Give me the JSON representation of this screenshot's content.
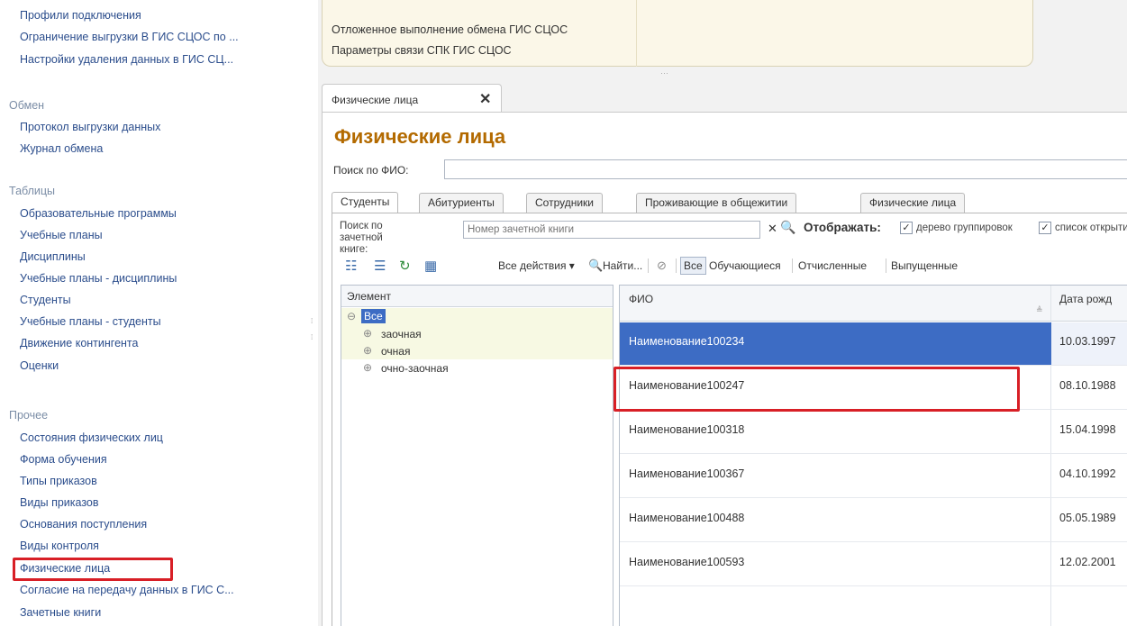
{
  "nav": {
    "items_top": [
      "Профили подключения",
      "Ограничение выгрузки В ГИС СЦОС по ...",
      "Настройки удаления данных в ГИС СЦ..."
    ],
    "section_exchange": "Обмен",
    "items_exchange": [
      "Протокол выгрузки данных",
      "Журнал обмена"
    ],
    "section_tables": "Таблицы",
    "items_tables": [
      "Образовательные программы",
      "Учебные планы",
      "Дисциплины",
      "Учебные планы - дисциплины",
      "Студенты",
      "Учебные планы - студенты",
      "Движение контингента",
      "Оценки"
    ],
    "section_other": "Прочее",
    "items_other": [
      "Состояния физических лиц",
      "Форма обучения",
      "Типы приказов",
      "Виды приказов",
      "Основания поступления",
      "Виды контроля",
      "Физические лица",
      "Согласие на передачу данных в ГИС С...",
      "Зачетные книги"
    ]
  },
  "top_panel": {
    "links": [
      "Отложенное выполнение обмена ГИС СЦОС",
      "Параметры связи СПК ГИС СЦОС"
    ],
    "grip": "⋯"
  },
  "doc_tab": {
    "label": "Физические лица",
    "close": "✕"
  },
  "form": {
    "title": "Физические лица",
    "search_label": "Поиск по ФИО:",
    "search_value": "",
    "tabs": [
      "Студенты",
      "Абитуриенты",
      "Сотрудники",
      "Проживающие в общежитии",
      "Физические лица"
    ],
    "record_book_label": "Поиск по зачетной книге:",
    "record_book_placeholder": "Номер зачетной книги",
    "clear_glyph": "✕",
    "find_glyph": "🔍",
    "display_label": "Отображать:",
    "check_tree_label": "дерево группировок",
    "check_list_label": "список открыти",
    "toolbar": {
      "all_actions": "Все действия ▾",
      "find": "Найти...",
      "filter_all": "Все",
      "filter_students": "Обучающиеся",
      "filter_expelled": "Отчисленные",
      "filter_graduated": "Выпущенные"
    }
  },
  "tree": {
    "header": "Элемент",
    "root": "Все",
    "items": [
      "заочная",
      "очная",
      "очно-заочная"
    ]
  },
  "grid": {
    "col_fio": "ФИО",
    "col_date": "Дата рожд",
    "rows": [
      {
        "fio": "Наименование100234",
        "date": "10.03.1997"
      },
      {
        "fio": "Наименование100247",
        "date": "08.10.1988"
      },
      {
        "fio": "Наименование100318",
        "date": "15.04.1998"
      },
      {
        "fio": "Наименование100367",
        "date": "04.10.1992"
      },
      {
        "fio": "Наименование100488",
        "date": "05.05.1989"
      },
      {
        "fio": "Наименование100593",
        "date": "12.02.2001"
      }
    ]
  },
  "colors": {
    "accent": "#b36a00",
    "selection": "#3d6cc4",
    "highlight": "#d81f26",
    "nav_link": "#2b4d8c"
  }
}
